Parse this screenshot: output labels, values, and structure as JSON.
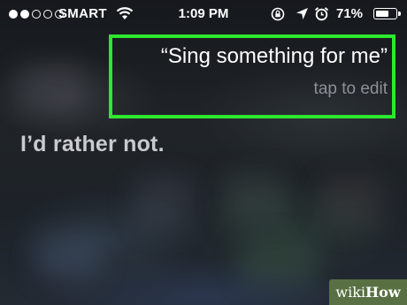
{
  "status_bar": {
    "signal_bars_filled": 2,
    "signal_bars_total": 5,
    "carrier": "SMART",
    "time": "1:09 PM",
    "battery_percent_text": "71%",
    "battery_level": 0.71,
    "icons": [
      "wifi-icon",
      "rotation-lock-icon",
      "location-icon",
      "alarm-icon",
      "battery-icon"
    ]
  },
  "siri": {
    "query": "“Sing something for me”",
    "edit_hint": "tap to edit",
    "reply": "I’d rather not."
  },
  "watermark": {
    "prefix": "wiki",
    "suffix": "How"
  },
  "colors": {
    "highlight": "#2ee82e",
    "hint_text": "#8d9097",
    "reply_text": "#c9cbcf"
  }
}
